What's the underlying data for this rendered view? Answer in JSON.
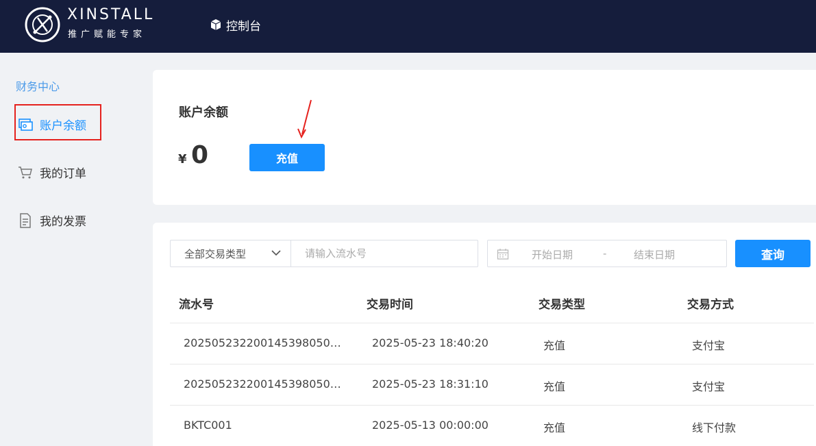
{
  "header": {
    "logo_title": "XINSTALL",
    "logo_subtitle": "推广赋能专家",
    "nav_console": "控制台",
    "background_color": "#151d3c"
  },
  "sidebar": {
    "section_title": "财务中心",
    "items": [
      {
        "label": "账户余额",
        "icon": "wallet-icon",
        "active": true
      },
      {
        "label": "我的订单",
        "icon": "cart-icon",
        "active": false
      },
      {
        "label": "我的发票",
        "icon": "document-icon",
        "active": false
      }
    ]
  },
  "balance": {
    "title": "账户余额",
    "currency": "¥",
    "amount": "0",
    "recharge_label": "充值"
  },
  "filters": {
    "type_select": "全部交易类型",
    "serial_placeholder": "请输入流水号",
    "date_start_placeholder": "开始日期",
    "date_separator": "-",
    "date_end_placeholder": "结束日期",
    "query_label": "查询"
  },
  "table": {
    "headers": [
      "流水号",
      "交易时间",
      "交易类型",
      "交易方式"
    ],
    "rows": [
      [
        "2025052322001453980506…",
        "2025-05-23 18:40:20",
        "充值",
        "支付宝"
      ],
      [
        "2025052322001453980506…",
        "2025-05-23 18:31:10",
        "充值",
        "支付宝"
      ],
      [
        "BKTC001",
        "2025-05-13 00:00:00",
        "充值",
        "线下付款"
      ]
    ]
  },
  "colors": {
    "accent": "#1890ff",
    "highlight": "#e5211d"
  }
}
